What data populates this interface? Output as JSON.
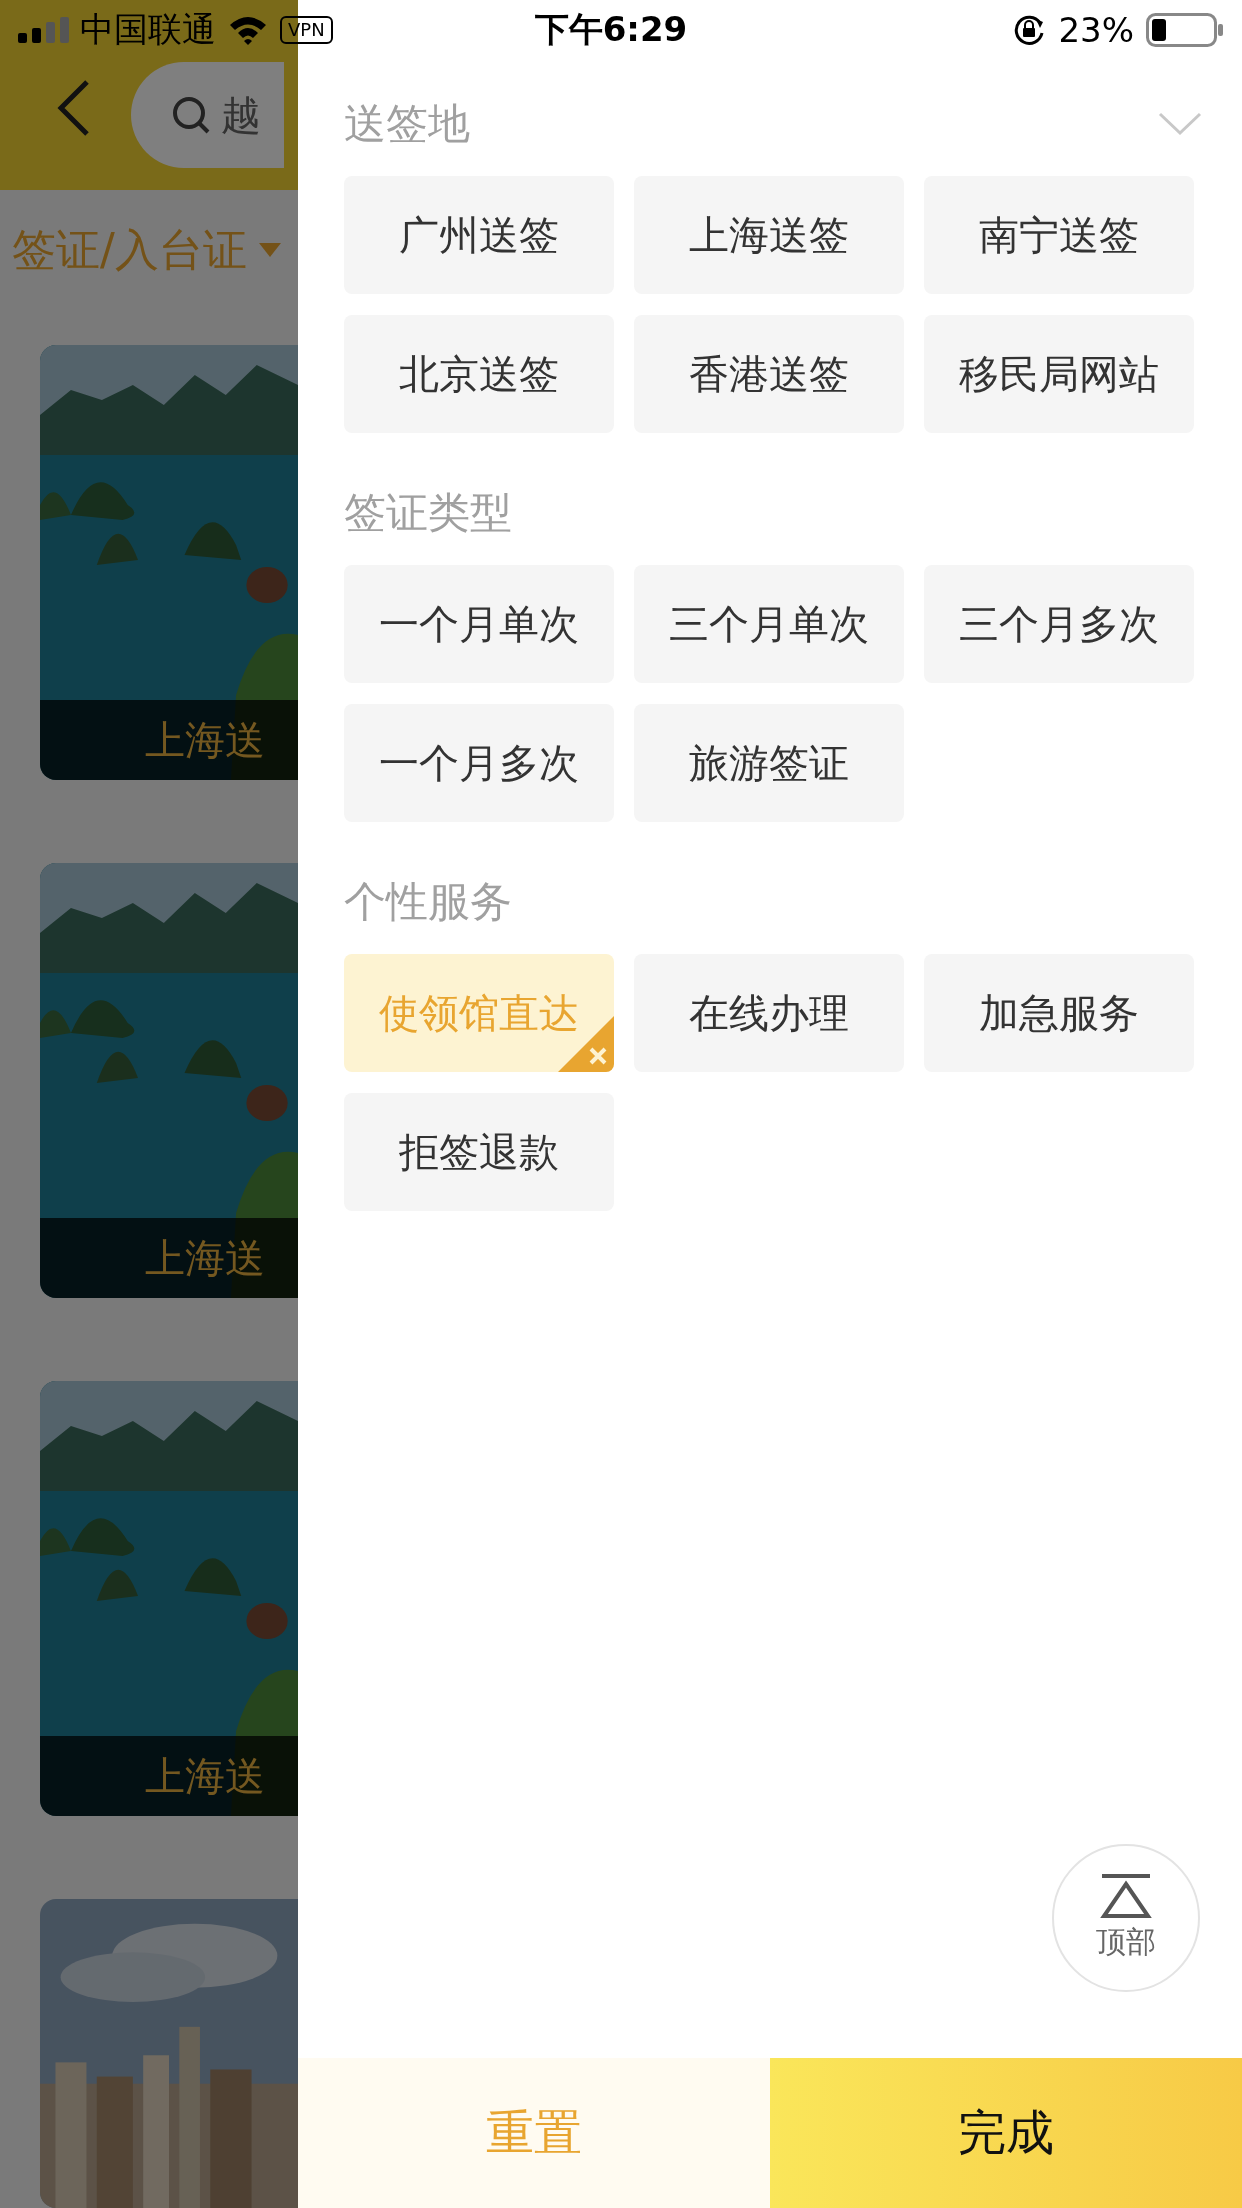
{
  "status_bar": {
    "carrier": "中国联通",
    "vpn": "VPN",
    "time": "下午6:29",
    "battery": "23%"
  },
  "header": {
    "search_text": "越"
  },
  "filter": {
    "label": "签证/入台证"
  },
  "cards": [
    {
      "kind": "captioned",
      "caption": "上海送"
    },
    {
      "kind": "captioned",
      "caption": "上海送"
    },
    {
      "kind": "captioned",
      "caption": "上海送"
    },
    {
      "kind": "picture"
    }
  ],
  "drawer": {
    "sections": [
      {
        "title": "送签地",
        "options": [
          {
            "label": "广州送签",
            "selected": false
          },
          {
            "label": "上海送签",
            "selected": false
          },
          {
            "label": "南宁送签",
            "selected": false
          },
          {
            "label": "北京送签",
            "selected": false
          },
          {
            "label": "香港送签",
            "selected": false
          },
          {
            "label": "移民局网站",
            "selected": false
          }
        ]
      },
      {
        "title": "签证类型",
        "options": [
          {
            "label": "一个月单次",
            "selected": false
          },
          {
            "label": "三个月单次",
            "selected": false
          },
          {
            "label": "三个月多次",
            "selected": false
          },
          {
            "label": "一个月多次",
            "selected": false
          },
          {
            "label": "旅游签证",
            "selected": false
          }
        ]
      },
      {
        "title": "个性服务",
        "options": [
          {
            "label": "使领馆直达",
            "selected": true
          },
          {
            "label": "在线办理",
            "selected": false
          },
          {
            "label": "加急服务",
            "selected": false
          },
          {
            "label": "拒签退款",
            "selected": false
          }
        ]
      }
    ],
    "top_button": "顶部",
    "reset": "重置",
    "done": "完成"
  }
}
